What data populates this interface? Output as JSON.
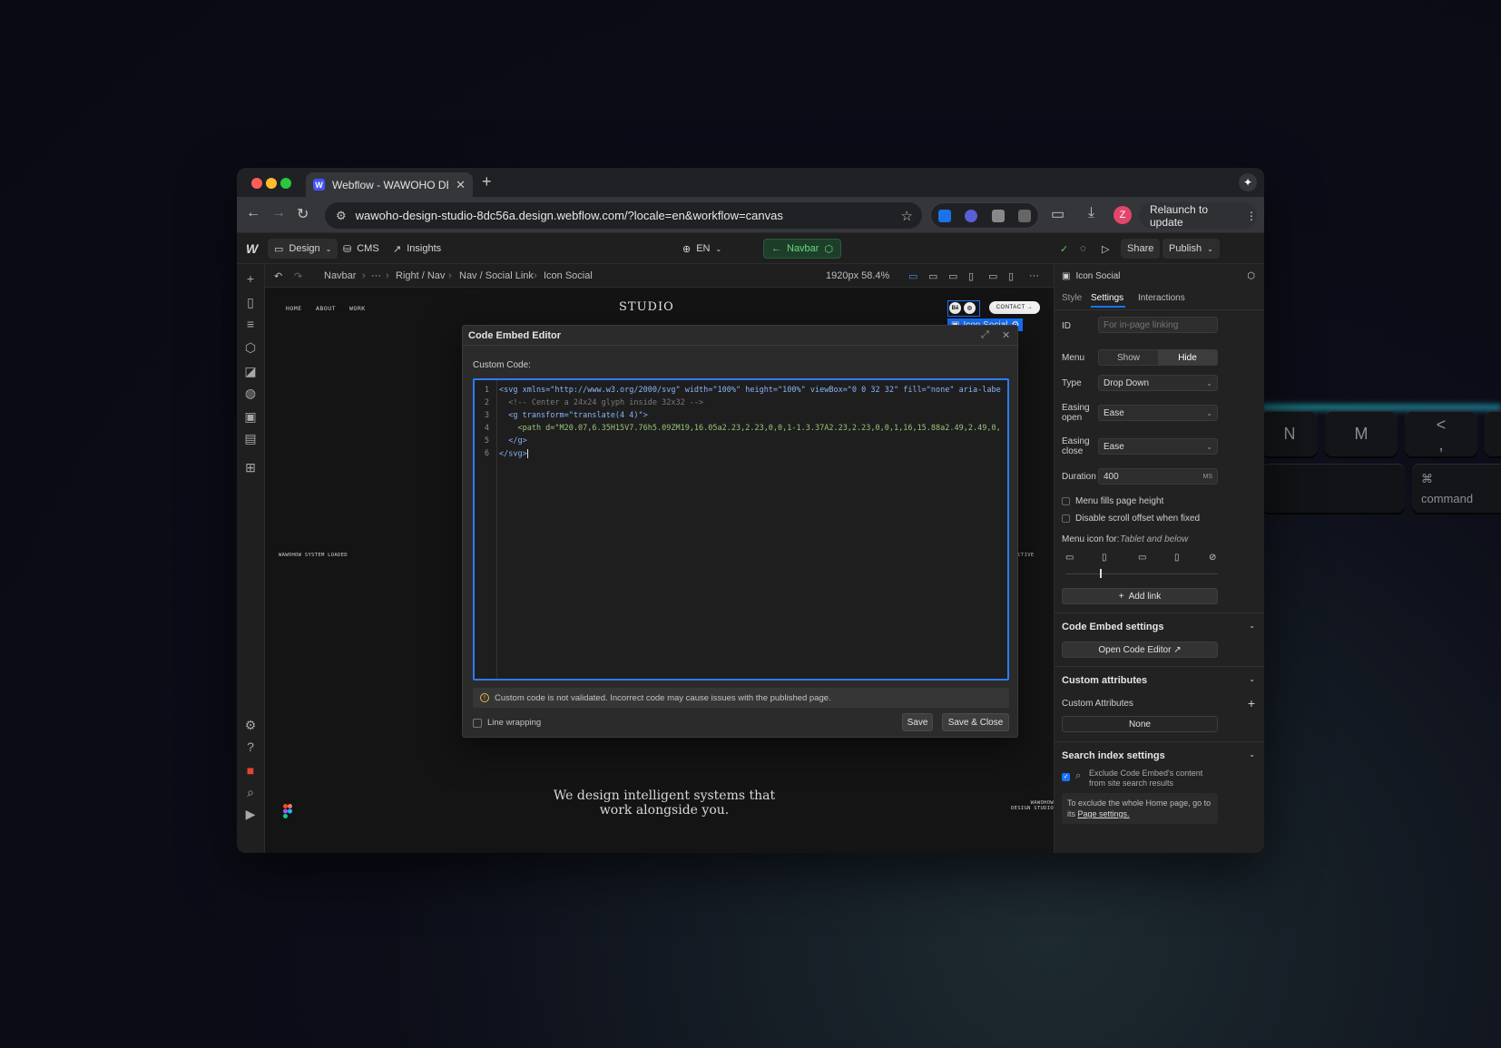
{
  "browser": {
    "tab_title": "Webflow - WAWOHO DESIGN",
    "tab_icon": "W",
    "url": "wawoho-design-studio-8dc56a.design.webflow.com/?locale=en&workflow=canvas",
    "relaunch_label": "Relaunch to update",
    "avatar_letter": "Z"
  },
  "toolbar": {
    "design_label": "Design",
    "cms_label": "CMS",
    "insights_label": "Insights",
    "language": "EN",
    "navbar_label": "Navbar",
    "share_label": "Share",
    "publish_label": "Publish"
  },
  "breadcrumb": {
    "items": [
      "Navbar",
      "···",
      "Right / Nav",
      "Nav / Social Link",
      "Icon Social"
    ],
    "viewport": "1920px 58.4%"
  },
  "canvas": {
    "nav_links": [
      "HOME",
      "ABOUT",
      "WORK"
    ],
    "logo": "STUDIO",
    "contact_label": "CONTACT →",
    "social_be": "Bē",
    "social_ring": "◎",
    "selection_badge": "Icon Social",
    "status_left": "WAWOHOW SYSTEM LOADED",
    "status_right": "AP ACTIVE",
    "hero_line1": "We design intelligent systems that",
    "hero_line2": "work alongside you.",
    "footer_brand_1": "WAWOHOW",
    "footer_brand_2": "DESIGN STUDIO"
  },
  "modal": {
    "title": "Code Embed Editor",
    "custom_code_label": "Custom Code:",
    "code_lines": [
      "<svg xmlns=\"http://www.w3.org/2000/svg\" width=\"100%\" height=\"100%\" viewBox=\"0 0 32 32\" fill=\"none\" aria-labe",
      "  <!-- Center a 24x24 glyph inside 32x32 -->",
      "  <g transform=\"translate(4 4)\">",
      "    <path d=\"M20.07,6.35H15V7.76h5.09ZM19,16.05a2.23,2.23,0,0,1-1.3.37A2.23,2.23,0,0,1,16,15.88a2.49,2.49,0,",
      "  </g>",
      "</svg>"
    ],
    "warning": "Custom code is not validated. Incorrect code may cause issues with the published page.",
    "line_wrapping_label": "Line wrapping",
    "save_label": "Save",
    "save_close_label": "Save & Close"
  },
  "panel": {
    "element_name": "Icon Social",
    "tabs": [
      "Style",
      "Settings",
      "Interactions"
    ],
    "active_tab": "Settings",
    "id_label": "ID",
    "id_placeholder": "For in-page linking",
    "menu_label": "Menu",
    "menu_show": "Show",
    "menu_hide": "Hide",
    "type_label": "Type",
    "type_value": "Drop Down",
    "easing_open_label": "Easing open",
    "easing_open_value": "Ease",
    "easing_close_label": "Easing close",
    "easing_close_value": "Ease",
    "duration_label": "Duration",
    "duration_value": "400",
    "duration_unit": "MS",
    "menu_fills_label": "Menu fills page height",
    "disable_scroll_label": "Disable scroll offset when fixed",
    "menu_icon_for_label": "Menu icon for:",
    "menu_icon_for_value": "Tablet and below",
    "add_link_label": "Add link",
    "code_embed_settings": "Code Embed settings",
    "open_code_editor": "Open Code Editor ↗",
    "custom_attributes_heading": "Custom attributes",
    "custom_attributes_label": "Custom Attributes",
    "custom_attributes_value": "None",
    "search_index_heading": "Search index settings",
    "exclude_label": "Exclude Code Embed's content from site search results",
    "exclude_note": "To exclude the whole Home page, go to its",
    "page_settings_link": "Page settings."
  },
  "keyboard": {
    "keys": [
      "N",
      "M",
      "<",
      ",",
      "⌘",
      "command"
    ]
  },
  "colors": {
    "accent_blue": "#1673ff",
    "navbar_green": "#6bd67e",
    "editor_border": "#2d7bf4",
    "warning_amber": "#e7b84a"
  }
}
